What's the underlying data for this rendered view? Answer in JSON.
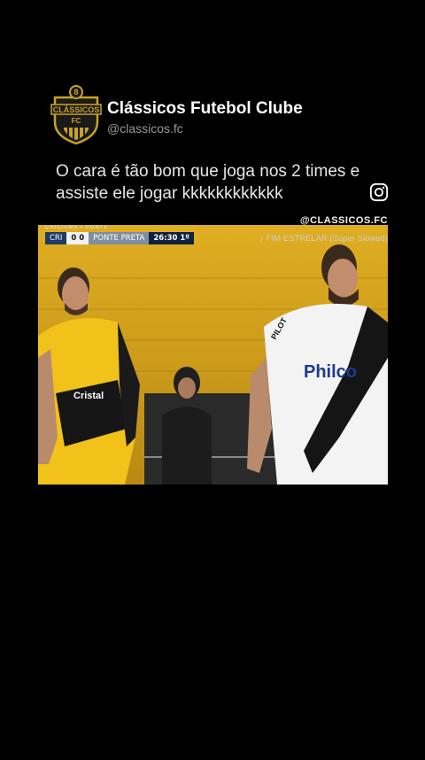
{
  "channel": {
    "logo_text": "CLÁSSICOS",
    "logo_sub": "FC",
    "logo_badge": "8",
    "name": "Clássicos Futebol Clube",
    "handle": "@classicos.fc"
  },
  "post": {
    "caption": "O cara é tão bom que joga nos 2 times e assiste ele jogar kkkkkkkkkkkk",
    "icon": "instagram-icon"
  },
  "video": {
    "watermark": "@CLASSICOS.FC",
    "music": "♪ FIM ESTRELAR (Super Slowed)",
    "scoreboard": {
      "top_label": "CRICIÚMA ▪ PONTE",
      "home": "CRI",
      "score": "0 0",
      "away": "PONTE PRETA",
      "clock": "26:30 1º"
    },
    "jersey_texts": {
      "left_sponsor": "Cristal",
      "right_sponsor": "Philco",
      "right_brand": "PILOT"
    }
  },
  "colors": {
    "background": "#000000",
    "logo_gold": "#c9a227",
    "crowd_yellow": "#d7a51f"
  }
}
